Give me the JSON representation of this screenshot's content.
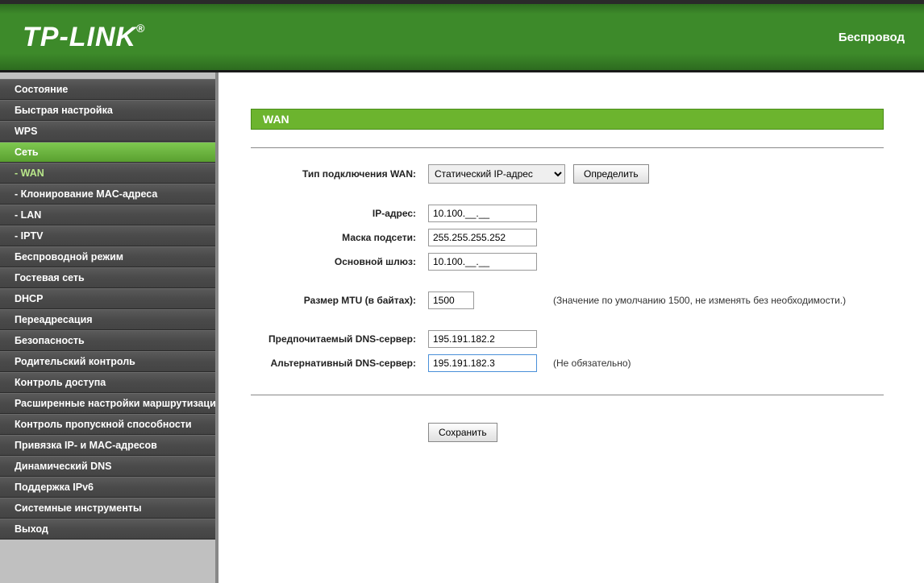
{
  "header": {
    "logo": "TP-LINK",
    "logo_reg": "®",
    "right_text": "Беспровод"
  },
  "sidebar": {
    "items": [
      {
        "label": "Состояние",
        "type": "item"
      },
      {
        "label": "Быстрая настройка",
        "type": "item"
      },
      {
        "label": "WPS",
        "type": "item"
      },
      {
        "label": "Сеть",
        "type": "active"
      },
      {
        "label": "- WAN",
        "type": "sub-active"
      },
      {
        "label": "- Клонирование MAC-адреса",
        "type": "sub"
      },
      {
        "label": "- LAN",
        "type": "sub"
      },
      {
        "label": "- IPTV",
        "type": "sub"
      },
      {
        "label": "Беспроводной режим",
        "type": "item"
      },
      {
        "label": "Гостевая сеть",
        "type": "item"
      },
      {
        "label": "DHCP",
        "type": "item"
      },
      {
        "label": "Переадресация",
        "type": "item"
      },
      {
        "label": "Безопасность",
        "type": "item"
      },
      {
        "label": "Родительский контроль",
        "type": "item"
      },
      {
        "label": "Контроль доступа",
        "type": "item"
      },
      {
        "label": "Расширенные настройки маршрутизации",
        "type": "item"
      },
      {
        "label": "Контроль пропускной способности",
        "type": "item"
      },
      {
        "label": "Привязка IP- и MAC-адресов",
        "type": "item"
      },
      {
        "label": "Динамический DNS",
        "type": "item"
      },
      {
        "label": "Поддержка IPv6",
        "type": "item"
      },
      {
        "label": "Системные инструменты",
        "type": "item"
      },
      {
        "label": "Выход",
        "type": "item"
      }
    ]
  },
  "content": {
    "page_title": "WAN",
    "wan_type_label": "Тип подключения WAN:",
    "wan_type_value": "Статический IP-адрес",
    "detect_button": "Определить",
    "ip_label": "IP-адрес:",
    "ip_value": "10.100.__.__",
    "mask_label": "Маска подсети:",
    "mask_value": "255.255.255.252",
    "gateway_label": "Основной шлюз:",
    "gateway_value": "10.100.__.__",
    "mtu_label": "Размер MTU (в байтах):",
    "mtu_value": "1500",
    "mtu_hint": "(Значение по умолчанию 1500, не изменять без необходимости.)",
    "dns1_label": "Предпочитаемый DNS-сервер:",
    "dns1_value": "195.191.182.2",
    "dns2_label": "Альтернативный DNS-сервер:",
    "dns2_value": "195.191.182.3",
    "dns2_hint": "(Не обязательно)",
    "save_button": "Сохранить"
  }
}
